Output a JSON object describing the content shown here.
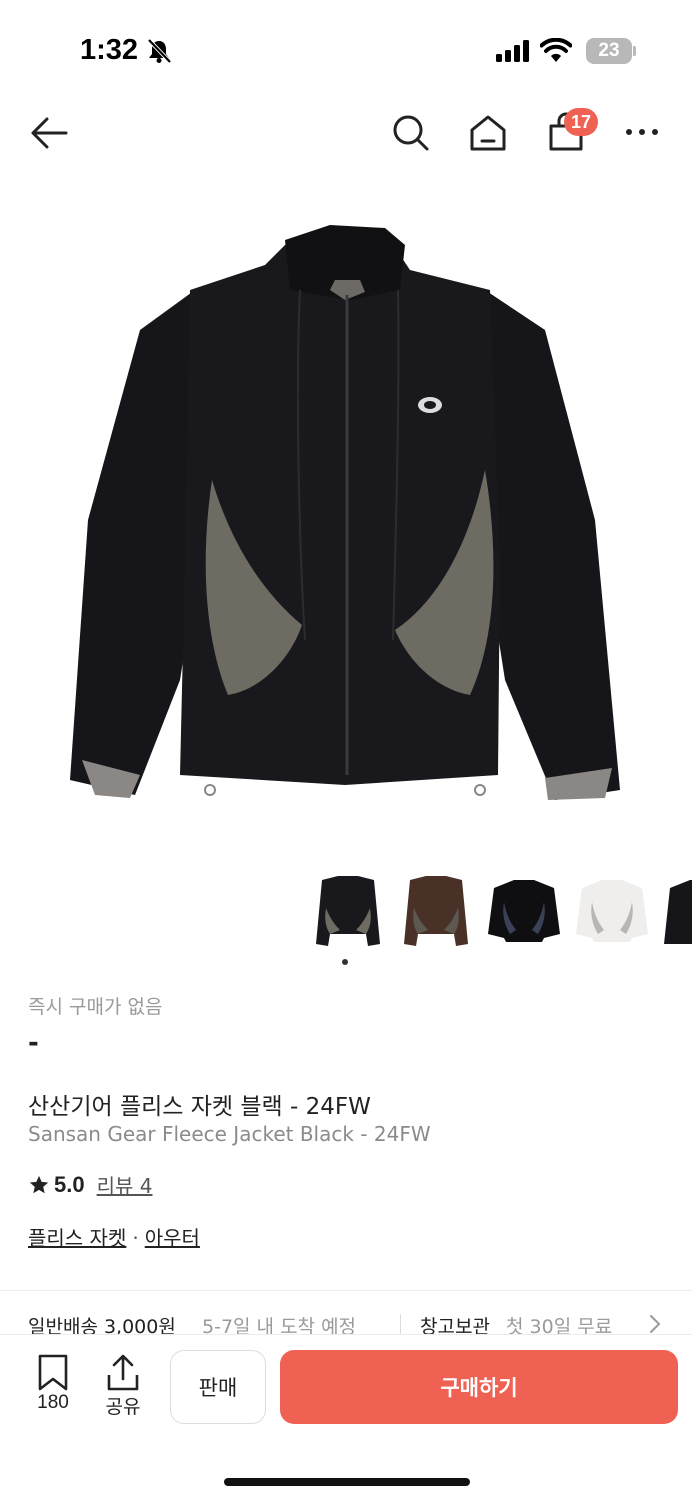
{
  "status_bar": {
    "time": "1:32",
    "battery": "23"
  },
  "header": {
    "cart_count": "17"
  },
  "thumbnails": [
    {
      "name": "black-grey"
    },
    {
      "name": "brown"
    },
    {
      "name": "black-navy"
    },
    {
      "name": "white"
    },
    {
      "name": "black-partial"
    }
  ],
  "product": {
    "instant_buy_label": "즉시 구매가 없음",
    "price": "-",
    "title_ko": "산산기어 플리스 자켓 블랙 - 24FW",
    "title_en": "Sansan Gear Fleece Jacket Black - 24FW",
    "rating": "5.0",
    "reviews_label": "리뷰 4",
    "category_1": "플리스 자켓",
    "category_separator": "·",
    "category_2": "아우터"
  },
  "shipping": {
    "general_label": "일반배송 3,000원",
    "general_eta": "5-7일 내 도착 예정",
    "storage_label": "창고보관",
    "storage_promo": "첫 30일 무료"
  },
  "bottom_bar": {
    "bookmark_count": "180",
    "share_label": "공유",
    "sell_label": "판매",
    "buy_label": "구매하기"
  },
  "colors": {
    "accent": "#ef6253",
    "muted": "#9a9a9a"
  }
}
